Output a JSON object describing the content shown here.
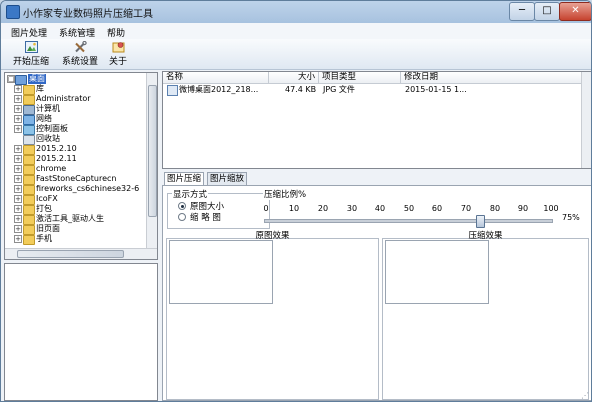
{
  "window": {
    "title": "小作家专业数码照片压缩工具",
    "min_glyph": "─",
    "max_glyph": "□",
    "close_glyph": "✕"
  },
  "menu": [
    {
      "label": "图片处理"
    },
    {
      "label": "系统管理"
    },
    {
      "label": "帮助"
    }
  ],
  "toolbar": {
    "start": "开始压缩",
    "settings": "系统设置",
    "about": "关于"
  },
  "tree": {
    "items": [
      {
        "label": "桌面",
        "expander": "□",
        "selected": true
      },
      {
        "label": "库",
        "expander": "+"
      },
      {
        "label": "Administrator",
        "expander": "+"
      },
      {
        "label": "计算机",
        "expander": "+"
      },
      {
        "label": "网络",
        "expander": "+"
      },
      {
        "label": "控制面板",
        "expander": "+"
      },
      {
        "label": "回收站",
        "expander": ""
      },
      {
        "label": "2015.2.10",
        "expander": "+"
      },
      {
        "label": "2015.2.11",
        "expander": "+"
      },
      {
        "label": "chrome",
        "expander": "+"
      },
      {
        "label": "FastStoneCapturecn",
        "expander": "+"
      },
      {
        "label": "fireworks_cs6chinese32-6",
        "expander": "+"
      },
      {
        "label": "IcoFX",
        "expander": "+"
      },
      {
        "label": "打包",
        "expander": "+"
      },
      {
        "label": "激活工具_驱动人生",
        "expander": "+"
      },
      {
        "label": "旧页面",
        "expander": "+"
      },
      {
        "label": "手机",
        "expander": "+"
      }
    ]
  },
  "file_list": {
    "columns": [
      "名称",
      "大小",
      "项目类型",
      "修改日期"
    ],
    "rows": [
      {
        "name": "微博桌面2012_218...",
        "size": "47.4 KB",
        "type": "JPG 文件",
        "date": "2015-01-15 1..."
      }
    ]
  },
  "tabs": [
    {
      "label": "图片压缩"
    },
    {
      "label": "图片缩放"
    }
  ],
  "display_mode": {
    "title": "显示方式",
    "options": [
      {
        "label": "原图大小",
        "checked": true
      },
      {
        "label": "缩 略 图",
        "checked": false
      }
    ]
  },
  "compression": {
    "title": "压缩比例%",
    "ticks": [
      "0",
      "10",
      "20",
      "30",
      "40",
      "50",
      "60",
      "70",
      "80",
      "90",
      "100"
    ],
    "value": 75,
    "value_label": "75%"
  },
  "preview": {
    "original": "原图效果",
    "compressed": "压缩效果"
  }
}
